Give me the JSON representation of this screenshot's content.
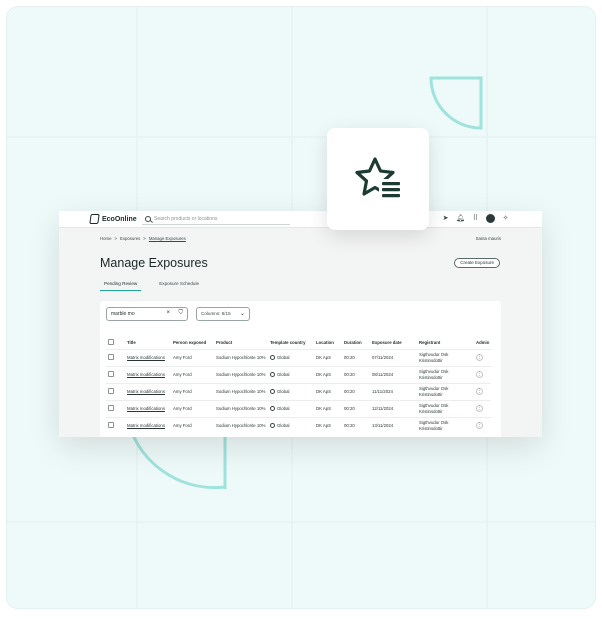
{
  "app": {
    "logo": "EcoOnline",
    "search_placeholder": "Search products or locations",
    "user_name": "Santa mauris"
  },
  "breadcrumb": [
    "Home",
    ">",
    "Exposures",
    ">",
    "Manage Exposures"
  ],
  "page": {
    "title": "Manage Exposures",
    "create_button": "Create Exposure",
    "tabs": [
      "Pending Review",
      "Exposure Schedule"
    ]
  },
  "filter": {
    "value": "marble mo",
    "columns_label": "Columns: 8/15"
  },
  "table": {
    "headers": [
      "Title",
      "Person exposed",
      "Product",
      "Template country",
      "Location",
      "Duration",
      "Exposure date",
      "Registrant",
      "Admin"
    ],
    "rows": [
      [
        "Matrix modifications",
        "Amy Ford",
        "Sodium Hypochlorite 10%",
        "Global",
        "DK ApS",
        "00:20",
        "07/11/2024",
        "Sigthvudur Osk Kristinsdottir"
      ],
      [
        "Matrix modifications",
        "Amy Ford",
        "Sodium Hypochlorite 10%",
        "Global",
        "DK ApS",
        "00:20",
        "08/11/2024",
        "Sigthvudur Osk Kristinsdottir"
      ],
      [
        "Matrix modifications",
        "Amy Ford",
        "Sodium Hypochlorite 10%",
        "Global",
        "DK ApS",
        "00:20",
        "11/11/2024",
        "Sigthvudur Osk Kristinsdottir"
      ],
      [
        "Matrix modifications",
        "Amy Ford",
        "Sodium Hypochlorite 10%",
        "Global",
        "DK ApS",
        "00:20",
        "12/11/2024",
        "Sigthvudur Osk Kristinsdottir"
      ],
      [
        "Matrix modifications",
        "Amy Ford",
        "Sodium Hypochlorite 10%",
        "Global",
        "DK ApS",
        "00:20",
        "13/11/2024",
        "Sigthvudur Osk Kristinsdottir"
      ]
    ]
  },
  "icons": {
    "feature": "star-list-icon"
  },
  "colors": {
    "background": "#eefaf9",
    "accent": "#21a594",
    "icon_dark": "#1d3b33",
    "deco_line": "#9fe3dc"
  }
}
